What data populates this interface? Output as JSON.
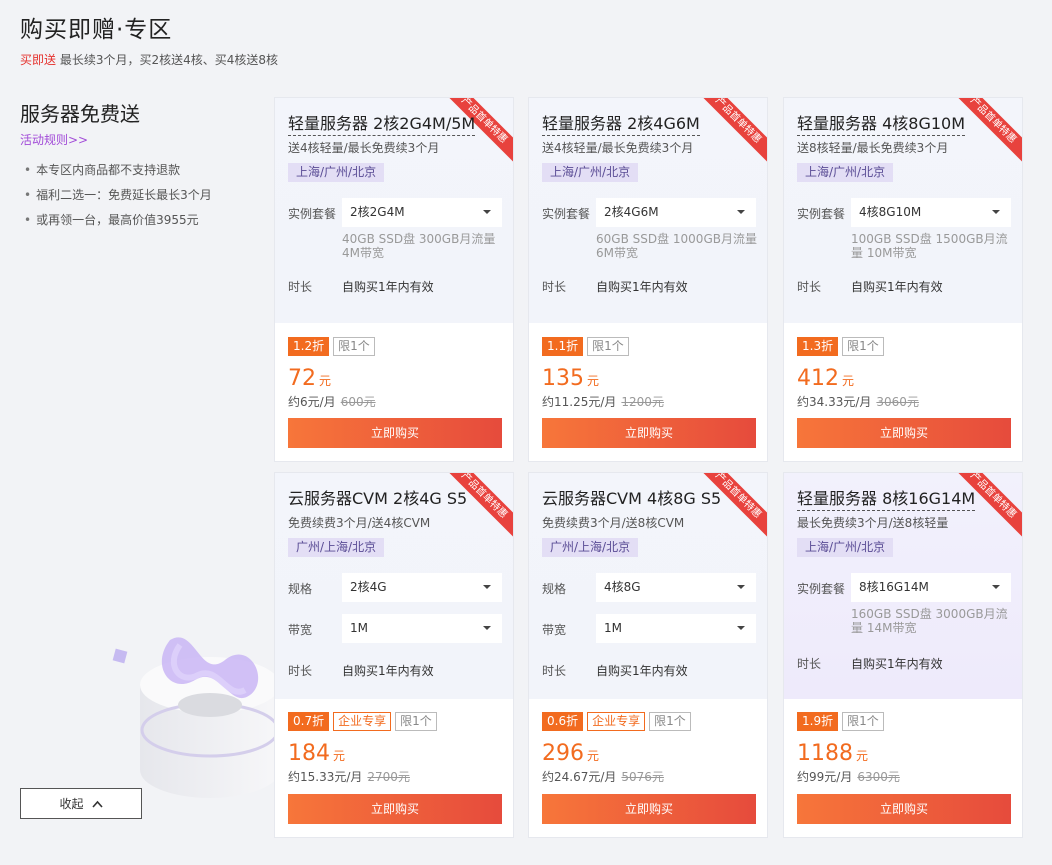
{
  "page": {
    "title": "购买即赠·专区",
    "subtitle_accent": "买即送",
    "subtitle_text": "最长续3个月，买2核送4核、买4核送8核"
  },
  "sidebar": {
    "title": "服务器免费送",
    "rules_link": "活动规则>>",
    "notes": [
      "本专区内商品都不支持退款",
      "福利二选一：免费延长最长3个月",
      "或再领一台，最高价值3955元"
    ],
    "collapse_label": "收起"
  },
  "cards": [
    {
      "ribbon": "产品首单特惠",
      "title": "轻量服务器 2核2G4M/5M",
      "desc": "送4核轻量/最长免费续3个月",
      "region": "上海/广州/北京",
      "plan_label": "实例套餐",
      "plan_value": "2核2G4M",
      "spec_note": "40GB SSD盘 300GB月流量 4M带宽",
      "duration_label": "时长",
      "duration_value": "自购买1年内有效",
      "discount": "1.2折",
      "limit": "限1个",
      "price": "72",
      "unit": "元",
      "monthly": "约6元/月",
      "original": "600元",
      "buy": "立即购买"
    },
    {
      "ribbon": "产品首单特惠",
      "title": "轻量服务器 2核4G6M",
      "desc": "送4核轻量/最长免费续3个月",
      "region": "上海/广州/北京",
      "plan_label": "实例套餐",
      "plan_value": "2核4G6M",
      "spec_note": "60GB SSD盘 1000GB月流量 6M带宽",
      "duration_label": "时长",
      "duration_value": "自购买1年内有效",
      "discount": "1.1折",
      "limit": "限1个",
      "price": "135",
      "unit": "元",
      "monthly": "约11.25元/月",
      "original": "1200元",
      "buy": "立即购买"
    },
    {
      "ribbon": "产品首单特惠",
      "title": "轻量服务器 4核8G10M",
      "desc": "送8核轻量/最长免费续3个月",
      "region": "上海/广州/北京",
      "plan_label": "实例套餐",
      "plan_value": "4核8G10M",
      "spec_note": "100GB SSD盘 1500GB月流量 10M带宽",
      "duration_label": "时长",
      "duration_value": "自购买1年内有效",
      "discount": "1.3折",
      "limit": "限1个",
      "price": "412",
      "unit": "元",
      "monthly": "约34.33元/月",
      "original": "3060元",
      "buy": "立即购买"
    },
    {
      "ribbon": "产品首单特惠",
      "title": "云服务器CVM 2核4G S5",
      "desc": "免费续费3个月/送4核CVM",
      "region": "广州/上海/北京",
      "spec_label": "规格",
      "spec_value": "2核4G",
      "bandwidth_label": "带宽",
      "bandwidth_value": "1M",
      "duration_label": "时长",
      "duration_value": "自购买1年内有效",
      "discount": "0.7折",
      "enterprise": "企业专享",
      "limit": "限1个",
      "price": "184",
      "unit": "元",
      "monthly": "约15.33元/月",
      "original": "2700元",
      "buy": "立即购买"
    },
    {
      "ribbon": "产品首单特惠",
      "title": "云服务器CVM 4核8G S5",
      "desc": "免费续费3个月/送8核CVM",
      "region": "广州/上海/北京",
      "spec_label": "规格",
      "spec_value": "4核8G",
      "bandwidth_label": "带宽",
      "bandwidth_value": "1M",
      "duration_label": "时长",
      "duration_value": "自购买1年内有效",
      "discount": "0.6折",
      "enterprise": "企业专享",
      "limit": "限1个",
      "price": "296",
      "unit": "元",
      "monthly": "约24.67元/月",
      "original": "5076元",
      "buy": "立即购买"
    },
    {
      "ribbon": "产品首单特惠",
      "title": "轻量服务器 8核16G14M",
      "desc": "最长免费续3个月/送8核轻量",
      "region": "上海/广州/北京",
      "plan_label": "实例套餐",
      "plan_value": "8核16G14M",
      "spec_note": "160GB SSD盘 3000GB月流量 14M带宽",
      "duration_label": "时长",
      "duration_value": "自购买1年内有效",
      "discount": "1.9折",
      "limit": "限1个",
      "price": "1188",
      "unit": "元",
      "monthly": "约99元/月",
      "original": "6300元",
      "buy": "立即购买"
    }
  ]
}
